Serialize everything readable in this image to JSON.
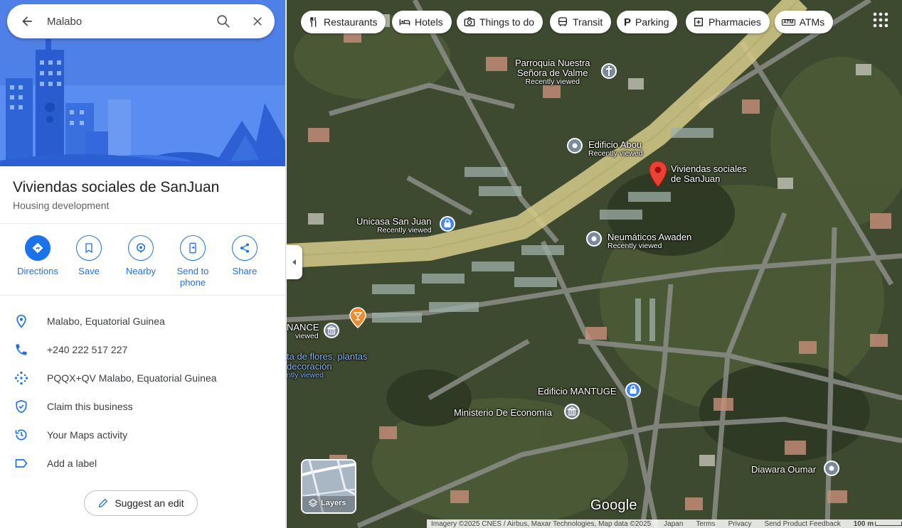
{
  "search": {
    "value": "Malabo"
  },
  "place": {
    "title": "Viviendas sociales de SanJuan",
    "category": "Housing development"
  },
  "actions": [
    {
      "label": "Directions"
    },
    {
      "label": "Save"
    },
    {
      "label": "Nearby"
    },
    {
      "label": "Send to\nphone"
    },
    {
      "label": "Share"
    }
  ],
  "info": [
    {
      "text": "Malabo, Equatorial Guinea",
      "icon": "location-pin-icon"
    },
    {
      "text": "+240 222 517 227",
      "icon": "phone-icon"
    },
    {
      "text": "PQQX+QV Malabo, Equatorial Guinea",
      "icon": "plus-code-icon"
    },
    {
      "text": "Claim this business",
      "icon": "shield-check-icon"
    },
    {
      "text": "Your Maps activity",
      "icon": "history-icon"
    },
    {
      "text": "Add a label",
      "icon": "label-icon"
    }
  ],
  "suggest_edit": "Suggest an edit",
  "chips": [
    {
      "label": "Restaurants",
      "icon": "fork-knife-icon"
    },
    {
      "label": "Hotels",
      "icon": "bed-icon"
    },
    {
      "label": "Things to do",
      "icon": "camera-icon"
    },
    {
      "label": "Transit",
      "icon": "bus-icon"
    },
    {
      "label": "Parking",
      "icon": "parking-icon"
    },
    {
      "label": "Pharmacies",
      "icon": "pharmacy-icon"
    },
    {
      "label": "ATMs",
      "icon": "atm-icon"
    }
  ],
  "map_labels": {
    "parroquia": "Parroquia Nuestra\nSeñora de Valme",
    "parroquia_sub": "Recently viewed",
    "edificio_abou": "Edificio Abou",
    "edificio_abou_sub": "Recently viewed",
    "viviendas": "Viviendas sociales\nde SanJuan",
    "unicasa": "Unicasa San Juan",
    "unicasa_sub": "Recently viewed",
    "neumaticos": "Neumáticos Awaden",
    "neumaticos_sub": "Recently viewed",
    "nance": "NANCE",
    "nance_sub": "viewed",
    "flores": "ta de flores, plantas\ndecoración",
    "flores_sub": "ntly viewed",
    "mantuge": "Edificio MANTUGE",
    "ministerio": "Ministerio De Economía",
    "diawara": "Diawara Oumar"
  },
  "layers_label": "Layers",
  "google_logo": "Google",
  "footer": {
    "imagery": "Imagery ©2025 CNES / Airbus, Maxar Technologies, Map data ©2025",
    "japan": "Japan",
    "terms": "Terms",
    "privacy": "Privacy",
    "feedback": "Send Product Feedback",
    "scale": "100 m"
  },
  "colors": {
    "accent": "#1a73e8",
    "hero": "#4f7fe6",
    "pin": "#ea4335"
  }
}
